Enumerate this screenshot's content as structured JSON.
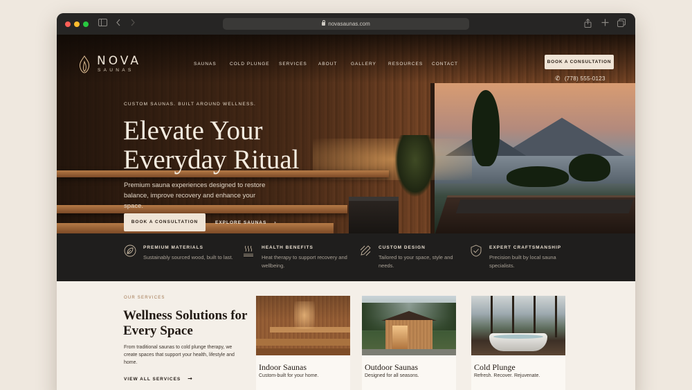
{
  "browser": {
    "url": "novasaunas.com"
  },
  "brand": {
    "name": "NOVA",
    "tagline": "SAUNAS"
  },
  "nav": {
    "items": [
      "SAUNAS",
      "COLD PLUNGE",
      "SERVICES",
      "ABOUT",
      "GALLERY",
      "RESOURCES",
      "CONTACT"
    ],
    "cta": "BOOK A CONSULTATION",
    "phone": "(778) 555-0123"
  },
  "hero": {
    "eyebrow": "CUSTOM SAUNAS. BUILT AROUND WELLNESS.",
    "headline_line1": "Elevate Your",
    "headline_line2": "Everyday Ritual",
    "subtext": "Premium sauna experiences designed to restore balance, improve recovery and enhance your space.",
    "primary_cta": "BOOK A CONSULTATION",
    "secondary_cta": "EXPLORE SAUNAS"
  },
  "features": [
    {
      "icon": "leaf-icon",
      "title": "PREMIUM MATERIALS",
      "desc": "Sustainably sourced wood, built to last."
    },
    {
      "icon": "steam-icon",
      "title": "HEALTH BENEFITS",
      "desc": "Heat therapy to support recovery and wellbeing."
    },
    {
      "icon": "pencil-ruler-icon",
      "title": "CUSTOM DESIGN",
      "desc": "Tailored to your space, style and needs."
    },
    {
      "icon": "shield-check-icon",
      "title": "EXPERT CRAFTSMANSHIP",
      "desc": "Precision built by local sauna specialists."
    }
  ],
  "services": {
    "eyebrow": "OUR SERVICES",
    "title": "Wellness Solutions for Every Space",
    "description": "From traditional saunas to cold plunge therapy, we create spaces that support your health, lifestyle and home.",
    "link": "VIEW ALL SERVICES",
    "cards": [
      {
        "title": "Indoor Saunas",
        "desc": "Custom-built for your home."
      },
      {
        "title": "Outdoor Saunas",
        "desc": "Designed for all seasons."
      },
      {
        "title": "Cold Plunge",
        "desc": "Refresh. Recover. Rejuvenate."
      }
    ]
  },
  "colors": {
    "accent_cream": "#efe4d6",
    "dark_strip": "#1f1e1d",
    "services_bg": "#f4efe8",
    "eyebrow_brown": "#a0764f"
  }
}
